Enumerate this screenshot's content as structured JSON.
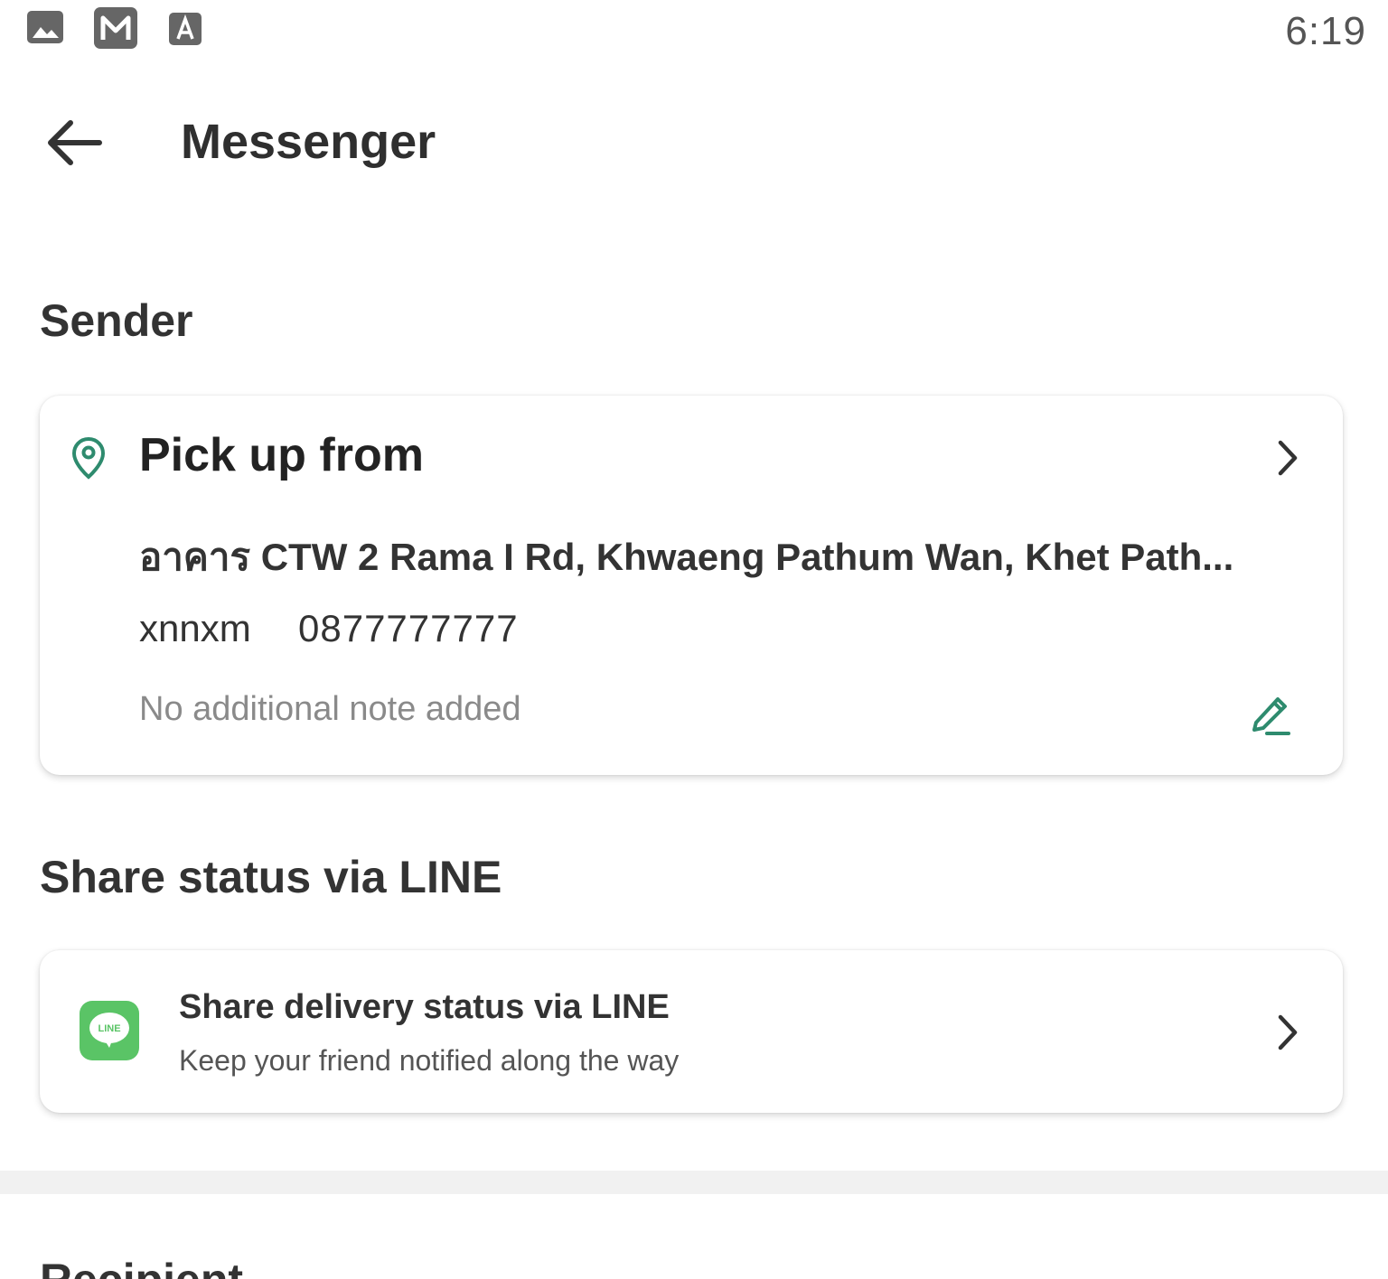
{
  "status_bar": {
    "time": "6:19",
    "icons": [
      "gallery-icon",
      "gmail-icon",
      "font-icon"
    ]
  },
  "app_bar": {
    "title": "Messenger",
    "back_icon": "arrow-left-icon"
  },
  "sender": {
    "section_title": "Sender",
    "card": {
      "title": "Pick up from",
      "address": "อาคาร CTW 2 Rama I Rd, Khwaeng Pathum Wan, Khet Path...",
      "contact_name": "xnnxm",
      "contact_phone": "0877777777",
      "note": "No additional note added"
    }
  },
  "share": {
    "section_title": "Share status via LINE",
    "card": {
      "title": "Share delivery status via LINE",
      "subtitle": "Keep your friend notified along the way",
      "logo_text": "LINE"
    }
  },
  "recipient": {
    "section_title": "Recipient"
  },
  "colors": {
    "accent_green": "#2e8b6e",
    "line_green": "#5ac466"
  }
}
